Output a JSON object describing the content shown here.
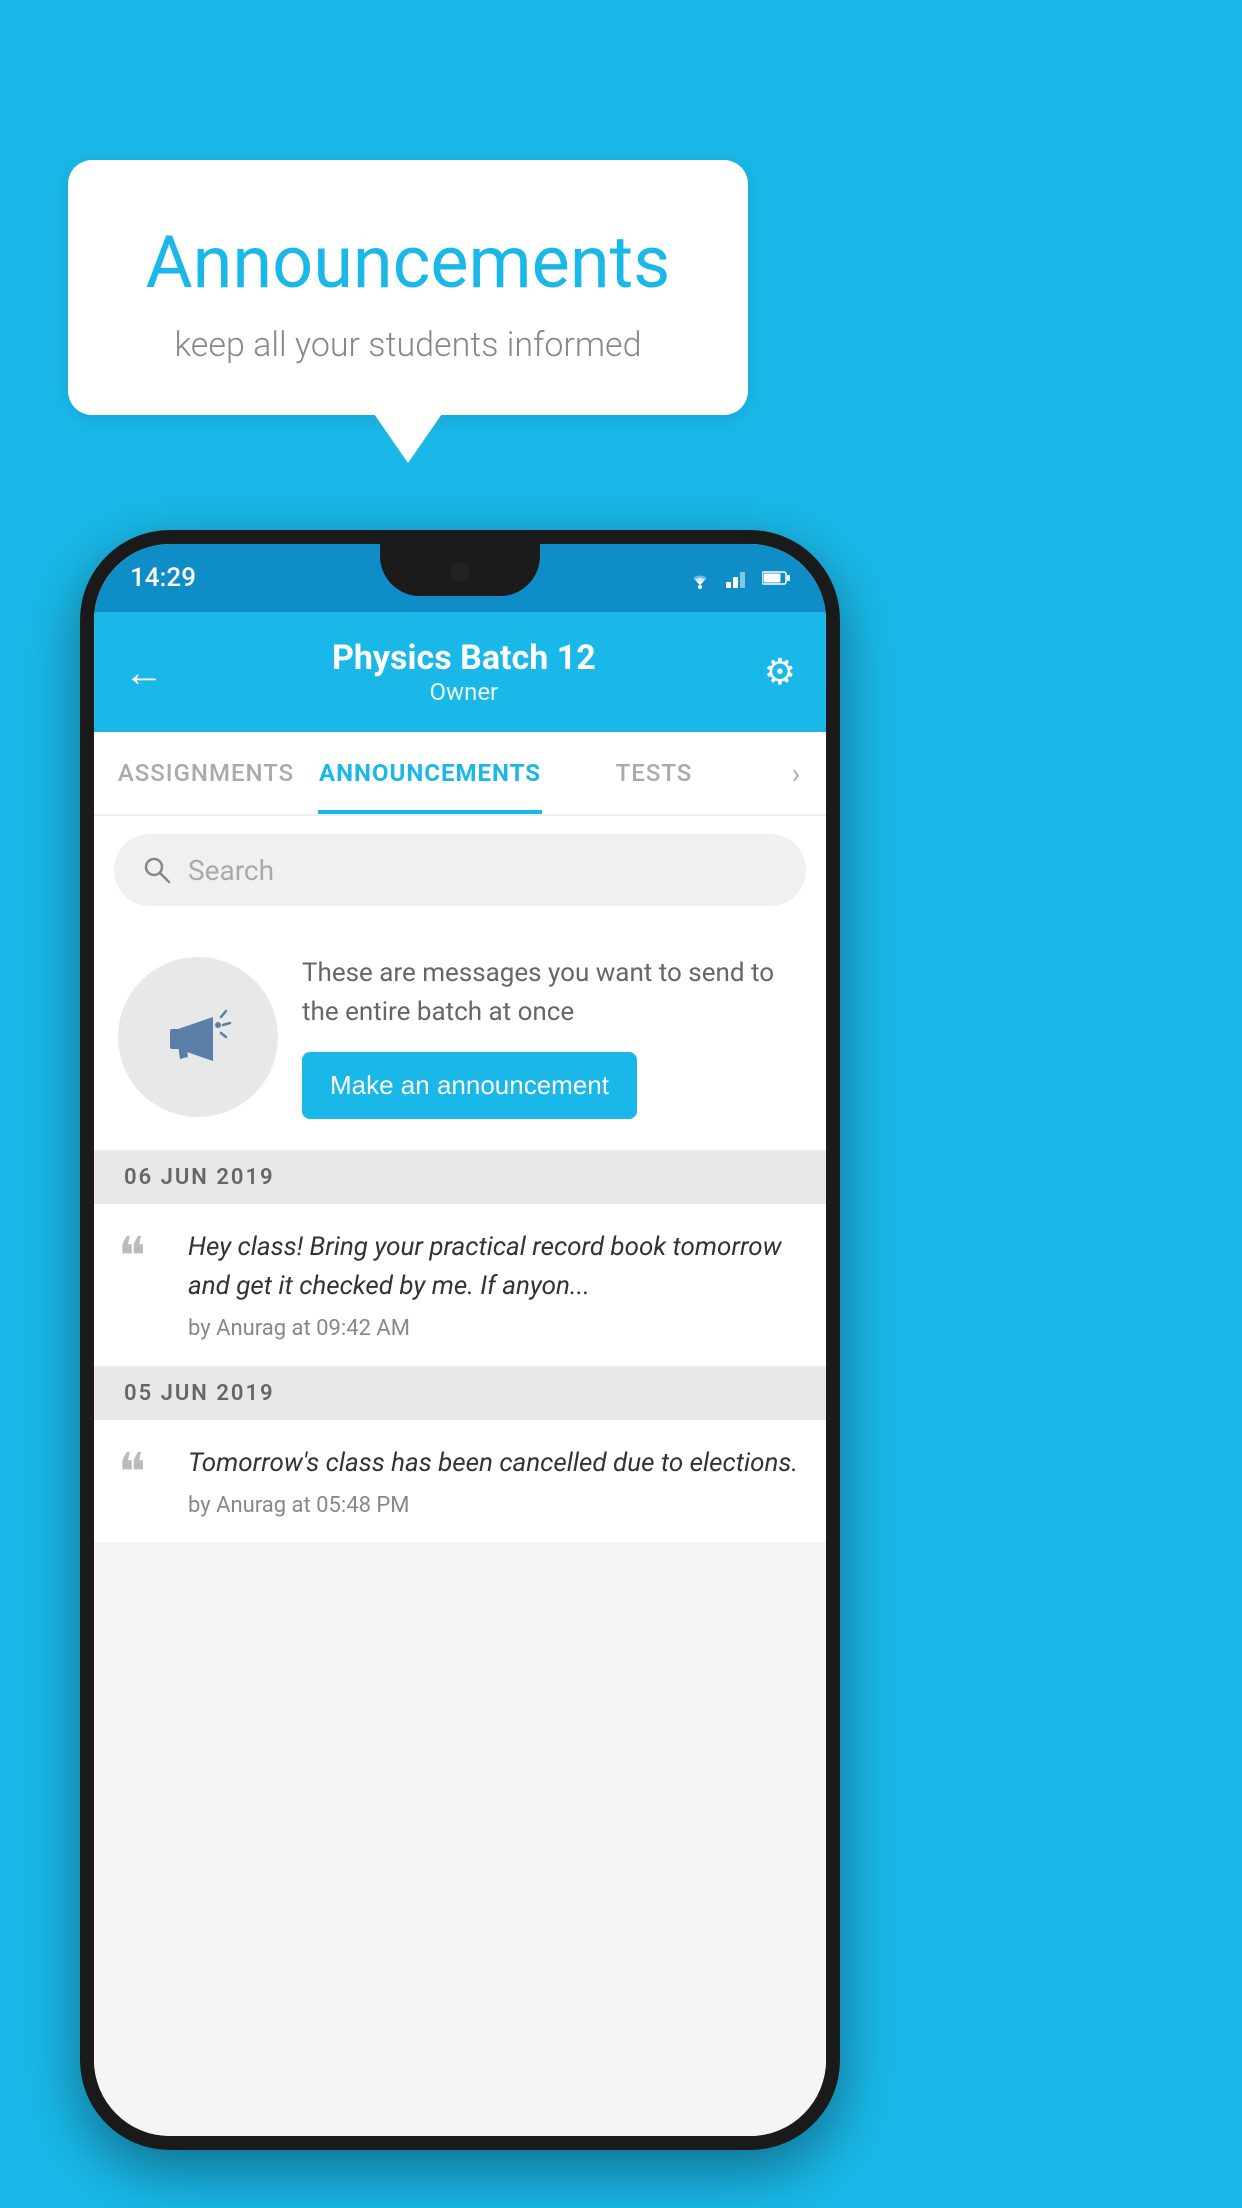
{
  "background_color": "#1ab8e8",
  "speech_bubble": {
    "title": "Announcements",
    "subtitle": "keep all your students informed"
  },
  "phone": {
    "status_bar": {
      "time": "14:29"
    },
    "app_bar": {
      "title": "Physics Batch 12",
      "subtitle": "Owner",
      "back_icon": "←",
      "gear_icon": "⚙"
    },
    "tabs": [
      {
        "label": "ASSIGNMENTS",
        "active": false
      },
      {
        "label": "ANNOUNCEMENTS",
        "active": true
      },
      {
        "label": "TESTS",
        "active": false
      }
    ],
    "search": {
      "placeholder": "Search"
    },
    "promo": {
      "description": "These are messages you want to send to the entire batch at once",
      "button_label": "Make an announcement"
    },
    "announcements": [
      {
        "date": "06  JUN  2019",
        "items": [
          {
            "text": "Hey class! Bring your practical record book tomorrow and get it checked by me. If anyon...",
            "meta": "by Anurag at 09:42 AM"
          }
        ]
      },
      {
        "date": "05  JUN  2019",
        "items": [
          {
            "text": "Tomorrow's class has been cancelled due to elections.",
            "meta": "by Anurag at 05:48 PM"
          }
        ]
      }
    ]
  }
}
